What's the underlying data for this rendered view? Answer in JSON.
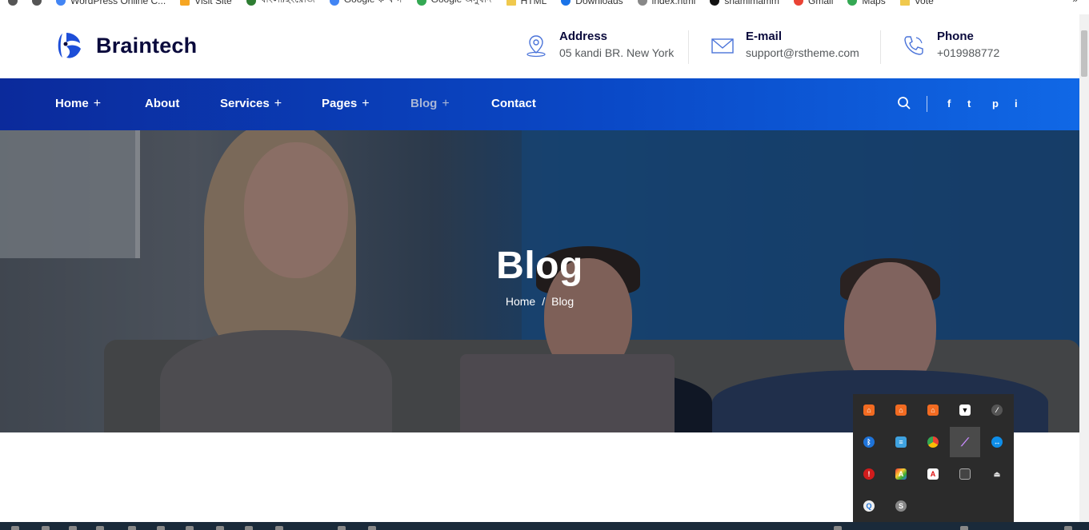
{
  "bookmarks": [
    {
      "label": "WordPress Online C..."
    },
    {
      "label": "Visit Site"
    },
    {
      "label": "বাংলা/ইংরেজি"
    },
    {
      "label": "Google ক খ গ"
    },
    {
      "label": "Google অনুবাদ"
    },
    {
      "label": "HTML"
    },
    {
      "label": "Downloads"
    },
    {
      "label": "index.html"
    },
    {
      "label": "shamimamm"
    },
    {
      "label": "Gmail"
    },
    {
      "label": "Maps"
    },
    {
      "label": "Vote"
    }
  ],
  "bookmarks_more": "»",
  "brand": {
    "name": "Braintech",
    "accent": "#1d4ed8"
  },
  "contact": [
    {
      "title": "Address",
      "value": "05 kandi BR. New York",
      "icon": "map-pin-icon"
    },
    {
      "title": "E-mail",
      "value": "support@rstheme.com",
      "icon": "envelope-icon"
    },
    {
      "title": "Phone",
      "value": "+019988772",
      "icon": "phone-icon"
    }
  ],
  "nav": {
    "items": [
      {
        "label": "Home",
        "plus": "+"
      },
      {
        "label": "About",
        "plus": ""
      },
      {
        "label": "Services",
        "plus": "+"
      },
      {
        "label": "Pages",
        "plus": "+"
      },
      {
        "label": "Blog",
        "plus": "+"
      },
      {
        "label": "Contact",
        "plus": ""
      }
    ],
    "social": [
      "f",
      "t",
      "p",
      "i"
    ]
  },
  "hero": {
    "title": "Blog",
    "breadcrumb": [
      "Home",
      "Blog"
    ],
    "separator": "/"
  },
  "tray_icons": [
    "xampp-icon",
    "xampp-icon",
    "xampp-icon",
    "shield-icon",
    "cloud-off-icon",
    "bluetooth-icon",
    "network-icon",
    "chrome-icon",
    "pen-icon",
    "teamviewer-icon",
    "antivirus-icon",
    "font-icon",
    "acrobat-icon",
    "display-icon",
    "usb-icon",
    "search-tool-icon",
    "skype-icon"
  ]
}
